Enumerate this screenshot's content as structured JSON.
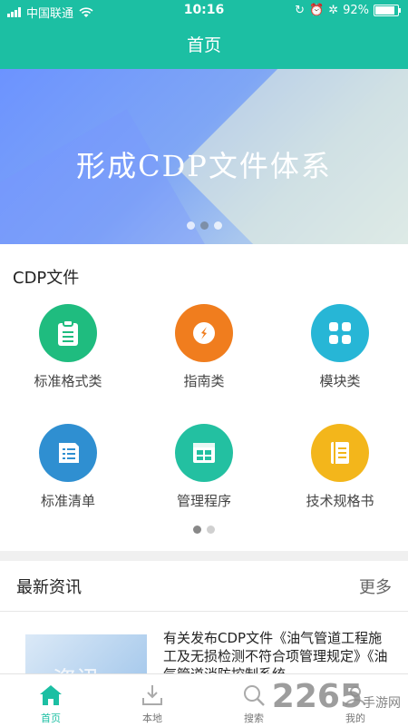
{
  "statusbar": {
    "carrier": "中国联通",
    "time": "10:16",
    "battery": "92%"
  },
  "navbar": {
    "title": "首页"
  },
  "banner": {
    "title": "形成CDP文件体系",
    "slides": 3,
    "active_slide": 2
  },
  "cdp": {
    "title": "CDP文件",
    "items": [
      {
        "label": "标准格式类",
        "color": "#1fbc7f",
        "icon": "clipboard-icon"
      },
      {
        "label": "指南类",
        "color": "#f07d1e",
        "icon": "compass-icon"
      },
      {
        "label": "模块类",
        "color": "#27b6d6",
        "icon": "grid-icon"
      },
      {
        "label": "标准清单",
        "color": "#2f8fd1",
        "icon": "list-icon"
      },
      {
        "label": "管理程序",
        "color": "#23c0a1",
        "icon": "window-icon"
      },
      {
        "label": "技术规格书",
        "color": "#f3b61b",
        "icon": "book-icon"
      }
    ],
    "pages": 2,
    "active_page": 1
  },
  "news": {
    "title": "最新资讯",
    "more": "更多",
    "items": [
      {
        "thumb_text": "资讯",
        "text": "有关发布CDP文件《油气管道工程施工及无损检测不符合项管理规定》《油气管道消防控制系统"
      }
    ]
  },
  "tabbar": {
    "items": [
      {
        "label": "首页",
        "icon": "home-icon",
        "active": true
      },
      {
        "label": "本地",
        "icon": "download-icon",
        "active": false
      },
      {
        "label": "搜索",
        "icon": "search-icon",
        "active": false
      },
      {
        "label": "我的",
        "icon": "user-icon",
        "active": false
      }
    ]
  },
  "watermark": {
    "number": "2265",
    "suffix": "手游网"
  },
  "colors": {
    "primary": "#1cbfa3"
  }
}
